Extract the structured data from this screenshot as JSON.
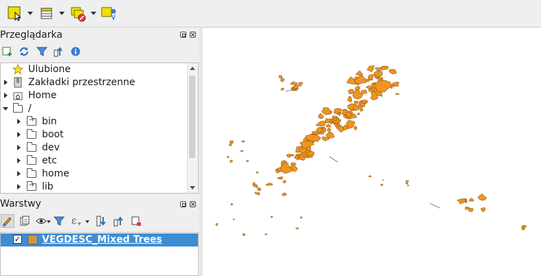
{
  "toolbar": {
    "buttons": [
      {
        "name": "select-features-icon",
        "has_menu": true
      },
      {
        "name": "attribute-table-icon",
        "has_menu": true
      },
      {
        "name": "deselect-features-icon",
        "has_menu": true
      },
      {
        "name": "identify-features-icon",
        "has_menu": false
      }
    ]
  },
  "browser": {
    "title": "Przeglądarka",
    "tools": [
      "add-layer-icon",
      "refresh-icon",
      "filter-icon",
      "collapse-all-icon",
      "info-icon"
    ],
    "items": [
      {
        "label": "Ulubione",
        "icon": "star-icon",
        "level": 0,
        "expander": "none"
      },
      {
        "label": "Zakładki przestrzenne",
        "icon": "bookmark-icon",
        "level": 0,
        "expander": "closed"
      },
      {
        "label": "Home",
        "icon": "home-icon",
        "level": 0,
        "expander": "closed"
      },
      {
        "label": "/",
        "icon": "folder-icon",
        "level": 0,
        "expander": "open"
      },
      {
        "label": "bin",
        "icon": "folder-link-icon",
        "level": 1,
        "expander": "closed"
      },
      {
        "label": "boot",
        "icon": "folder-icon",
        "level": 1,
        "expander": "closed"
      },
      {
        "label": "dev",
        "icon": "folder-icon",
        "level": 1,
        "expander": "closed"
      },
      {
        "label": "etc",
        "icon": "folder-icon",
        "level": 1,
        "expander": "closed"
      },
      {
        "label": "home",
        "icon": "folder-icon",
        "level": 1,
        "expander": "closed"
      },
      {
        "label": "lib",
        "icon": "folder-link-icon",
        "level": 1,
        "expander": "closed"
      }
    ]
  },
  "layers": {
    "title": "Warstwy",
    "tools": [
      "style-icon",
      "add-group-icon",
      "visibility-icon",
      "filter-icon",
      "expression-filter-icon",
      "expand-all-icon",
      "collapse-all-icon",
      "remove-layer-icon"
    ],
    "items": [
      {
        "label": "VEGDESC_Mixed Trees",
        "checked": true,
        "selected": true,
        "check_mark": "✓"
      }
    ]
  },
  "colors": {
    "selection": "#3b8ed4",
    "layer_fill": "#f0941f",
    "layer_stroke": "#8a5a16",
    "swatch": "#c49a52"
  }
}
